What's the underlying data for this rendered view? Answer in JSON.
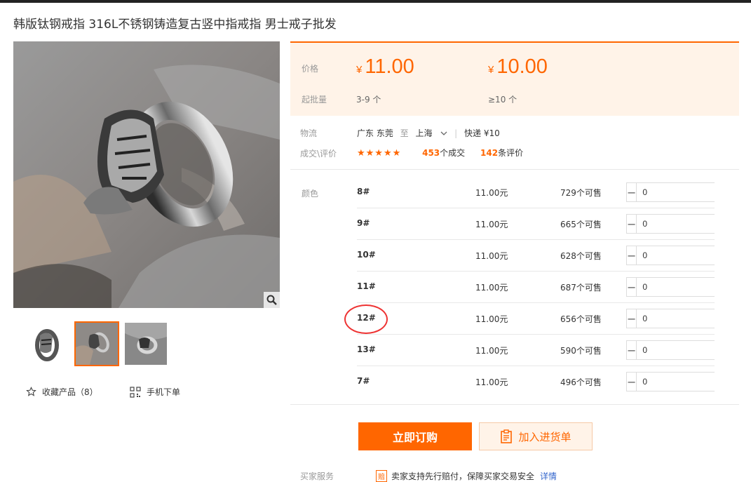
{
  "product": {
    "title": "韩版钛钢戒指 316L不锈钢铸造复古竖中指戒指 男士戒子批发"
  },
  "gallery": {
    "zoom_icon": "magnifier-icon",
    "favorite_label": "收藏产品（8）",
    "mobile_order_label": "手机下单",
    "selected_thumb": 2
  },
  "pricing": {
    "price_label": "价格",
    "moq_label": "起批量",
    "currency": "¥",
    "tiers": [
      {
        "price": "11.00",
        "qty": "3-9 个"
      },
      {
        "price": "10.00",
        "qty": "≥10 个"
      }
    ]
  },
  "logistics": {
    "label": "物流",
    "from": "广东 东莞",
    "to_word": "至",
    "to": "上海",
    "shipping": "快递 ¥10"
  },
  "reviews": {
    "label": "成交\\评价",
    "stars": "★★★★★",
    "deals_count": "453",
    "deals_suffix": "个成交",
    "review_count": "142",
    "review_suffix": "条评价"
  },
  "sku": {
    "label": "颜色",
    "rows": [
      {
        "name": "8#",
        "price": "11.00元",
        "stock": "729个可售",
        "qty": "0"
      },
      {
        "name": "9#",
        "price": "11.00元",
        "stock": "665个可售",
        "qty": "0"
      },
      {
        "name": "10#",
        "price": "11.00元",
        "stock": "628个可售",
        "qty": "0"
      },
      {
        "name": "11#",
        "price": "11.00元",
        "stock": "687个可售",
        "qty": "0"
      },
      {
        "name": "12#",
        "price": "11.00元",
        "stock": "656个可售",
        "qty": "0"
      },
      {
        "name": "13#",
        "price": "11.00元",
        "stock": "590个可售",
        "qty": "0"
      },
      {
        "name": "7#",
        "price": "11.00元",
        "stock": "496个可售",
        "qty": "0"
      }
    ]
  },
  "actions": {
    "buy_now": "立即订购",
    "add_to_list": "加入进货单"
  },
  "service": {
    "label": "买家服务",
    "badge": "赔",
    "text": "卖家支持先行赔付，保障买家交易安全",
    "link": "详情"
  },
  "colors": {
    "accent": "#ff6600",
    "highlight_circle": "#e33333"
  }
}
